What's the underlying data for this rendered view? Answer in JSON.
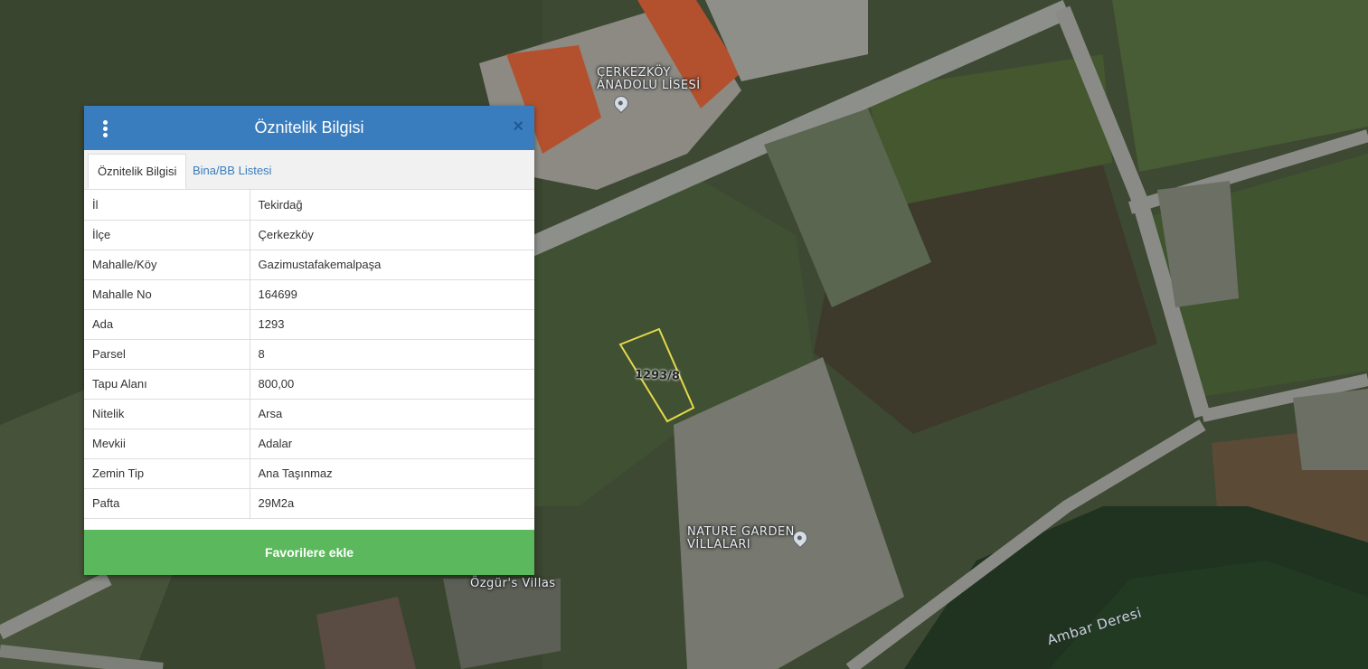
{
  "map": {
    "labels": {
      "school_line1": "ÇERKEZKÖY",
      "school_line2": "ANADOLU LİSESİ",
      "garden_line1": "NATURE GARDEN",
      "garden_line2": "VİLLALARI",
      "villas": "Özgür's Villas",
      "stream": "Ambar Deresi",
      "parcel": "1293/8"
    }
  },
  "panel": {
    "title": "Öznitelik Bilgisi",
    "tabs": [
      {
        "label": "Öznitelik Bilgisi",
        "active": true
      },
      {
        "label": "Bina/BB Listesi",
        "active": false
      }
    ],
    "rows": [
      {
        "key": "İl",
        "value": "Tekirdağ"
      },
      {
        "key": "İlçe",
        "value": "Çerkezköy"
      },
      {
        "key": "Mahalle/Köy",
        "value": "Gazimustafakemalpaşa"
      },
      {
        "key": "Mahalle No",
        "value": "164699"
      },
      {
        "key": "Ada",
        "value": "1293"
      },
      {
        "key": "Parsel",
        "value": "8"
      },
      {
        "key": "Tapu Alanı",
        "value": "800,00"
      },
      {
        "key": "Nitelik",
        "value": "Arsa"
      },
      {
        "key": "Mevkii",
        "value": "Adalar"
      },
      {
        "key": "Zemin Tip",
        "value": "Ana Taşınmaz"
      },
      {
        "key": "Pafta",
        "value": "29M2a"
      }
    ],
    "favorite_button": "Favorilere ekle",
    "close_symbol": "×"
  },
  "colors": {
    "header": "#3a7dbe",
    "button": "#5cb85c",
    "parcel_outline": "#e6d84a"
  }
}
